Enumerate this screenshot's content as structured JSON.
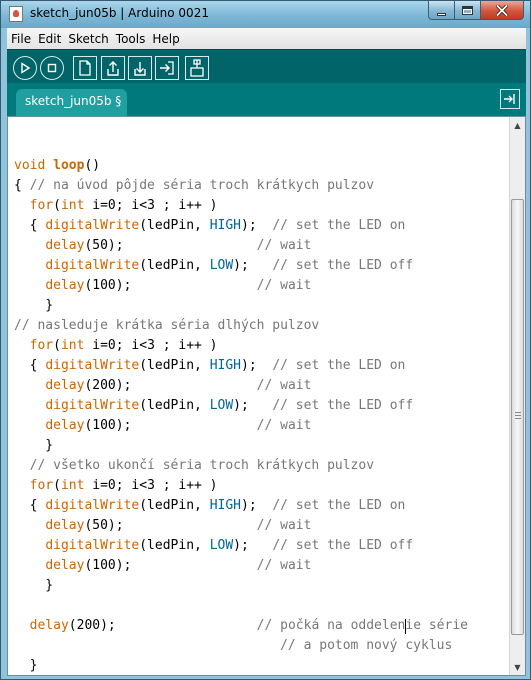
{
  "window": {
    "title": "sketch_jun05b | Arduino 0021"
  },
  "menu": [
    "File",
    "Edit",
    "Sketch",
    "Tools",
    "Help"
  ],
  "toolbar": {
    "buttons": [
      "verify-icon",
      "stop-icon",
      "new-icon",
      "open-icon",
      "save-icon",
      "upload-icon",
      "serial-monitor-icon"
    ]
  },
  "tabs": {
    "active": "sketch_jun05b §"
  },
  "colors": {
    "toolbar_bg": "#006468",
    "tabstrip_bg": "#00797c",
    "tab_bg": "#1f9f9f",
    "keyword": "#cc6600",
    "constant": "#006699",
    "comment": "#777777"
  },
  "code": [
    [],
    [
      [
        "void ",
        "kw-type"
      ],
      [
        "loop",
        "kw-fn"
      ],
      [
        "()",
        ""
      ]
    ],
    [
      [
        "{ ",
        ""
      ],
      [
        "// na úvod pôjde séria troch krátkych pulzov",
        "cmt"
      ]
    ],
    [
      [
        "  ",
        ""
      ],
      [
        "for",
        "kw-type"
      ],
      [
        "(",
        ""
      ],
      [
        "int",
        "kw-type"
      ],
      [
        " i=0; i<3 ; i++ )",
        ""
      ]
    ],
    [
      [
        "  { ",
        ""
      ],
      [
        "digitalWrite",
        "kw-func"
      ],
      [
        "(ledPin, ",
        ""
      ],
      [
        "HIGH",
        "kw-const"
      ],
      [
        ");  ",
        ""
      ],
      [
        "// set the LED on",
        "cmt"
      ]
    ],
    [
      [
        "    ",
        ""
      ],
      [
        "delay",
        "kw-func"
      ],
      [
        "(50);",
        ""
      ],
      [
        "                 ",
        ""
      ],
      [
        "// wait",
        "cmt"
      ]
    ],
    [
      [
        "    ",
        ""
      ],
      [
        "digitalWrite",
        "kw-func"
      ],
      [
        "(ledPin, ",
        ""
      ],
      [
        "LOW",
        "kw-const"
      ],
      [
        ");   ",
        ""
      ],
      [
        "// set the LED off",
        "cmt"
      ]
    ],
    [
      [
        "    ",
        ""
      ],
      [
        "delay",
        "kw-func"
      ],
      [
        "(100);",
        ""
      ],
      [
        "                ",
        ""
      ],
      [
        "// wait",
        "cmt"
      ]
    ],
    [
      [
        "    }",
        ""
      ]
    ],
    [
      [
        "// nasleduje krátka séria dlhých pulzov",
        "cmt"
      ]
    ],
    [
      [
        "  ",
        ""
      ],
      [
        "for",
        "kw-type"
      ],
      [
        "(",
        ""
      ],
      [
        "int",
        "kw-type"
      ],
      [
        " i=0; i<3 ; i++ )",
        ""
      ]
    ],
    [
      [
        "  { ",
        ""
      ],
      [
        "digitalWrite",
        "kw-func"
      ],
      [
        "(ledPin, ",
        ""
      ],
      [
        "HIGH",
        "kw-const"
      ],
      [
        ");  ",
        ""
      ],
      [
        "// set the LED on",
        "cmt"
      ]
    ],
    [
      [
        "    ",
        ""
      ],
      [
        "delay",
        "kw-func"
      ],
      [
        "(200);",
        ""
      ],
      [
        "                ",
        ""
      ],
      [
        "// wait",
        "cmt"
      ]
    ],
    [
      [
        "    ",
        ""
      ],
      [
        "digitalWrite",
        "kw-func"
      ],
      [
        "(ledPin, ",
        ""
      ],
      [
        "LOW",
        "kw-const"
      ],
      [
        ");   ",
        ""
      ],
      [
        "// set the LED off",
        "cmt"
      ]
    ],
    [
      [
        "    ",
        ""
      ],
      [
        "delay",
        "kw-func"
      ],
      [
        "(100);",
        ""
      ],
      [
        "                ",
        ""
      ],
      [
        "// wait",
        "cmt"
      ]
    ],
    [
      [
        "    }",
        ""
      ]
    ],
    [
      [
        "  ",
        ""
      ],
      [
        "// všetko ukončí séria troch krátkych pulzov",
        "cmt"
      ]
    ],
    [
      [
        "  ",
        ""
      ],
      [
        "for",
        "kw-type"
      ],
      [
        "(",
        ""
      ],
      [
        "int",
        "kw-type"
      ],
      [
        " i=0; i<3 ; i++ )",
        ""
      ]
    ],
    [
      [
        "  { ",
        ""
      ],
      [
        "digitalWrite",
        "kw-func"
      ],
      [
        "(ledPin, ",
        ""
      ],
      [
        "HIGH",
        "kw-const"
      ],
      [
        ");  ",
        ""
      ],
      [
        "// set the LED on",
        "cmt"
      ]
    ],
    [
      [
        "    ",
        ""
      ],
      [
        "delay",
        "kw-func"
      ],
      [
        "(50);",
        ""
      ],
      [
        "                 ",
        ""
      ],
      [
        "// wait",
        "cmt"
      ]
    ],
    [
      [
        "    ",
        ""
      ],
      [
        "digitalWrite",
        "kw-func"
      ],
      [
        "(ledPin, ",
        ""
      ],
      [
        "LOW",
        "kw-const"
      ],
      [
        ");   ",
        ""
      ],
      [
        "// set the LED off",
        "cmt"
      ]
    ],
    [
      [
        "    ",
        ""
      ],
      [
        "delay",
        "kw-func"
      ],
      [
        "(100);",
        ""
      ],
      [
        "                ",
        ""
      ],
      [
        "// wait",
        "cmt"
      ]
    ],
    [
      [
        "    }",
        ""
      ]
    ],
    [],
    [
      [
        "  ",
        ""
      ],
      [
        "delay",
        "kw-func"
      ],
      [
        "(200);",
        ""
      ],
      [
        "                  ",
        ""
      ],
      [
        "// počká na oddelenie série",
        "cmt"
      ]
    ],
    [
      [
        "                                  ",
        ""
      ],
      [
        "// a potom nový cyklus",
        "cmt"
      ]
    ],
    [
      [
        "  }",
        ""
      ]
    ]
  ]
}
